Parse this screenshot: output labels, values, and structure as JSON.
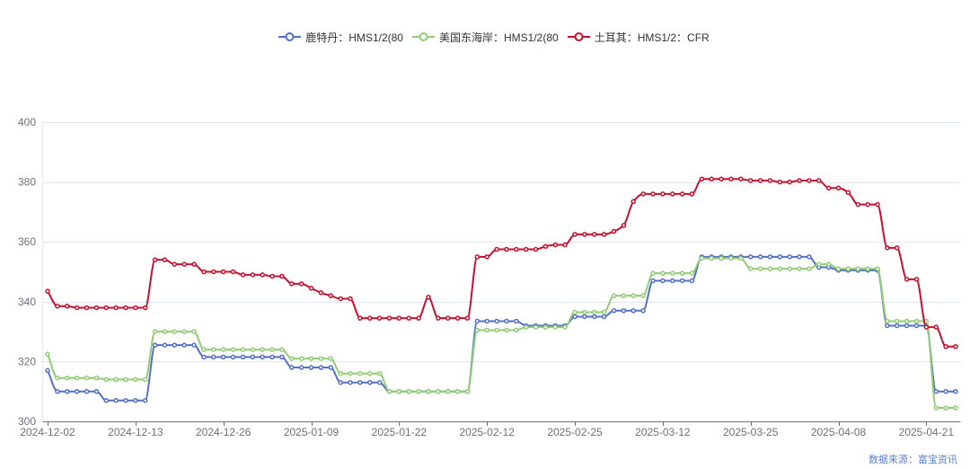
{
  "source": "数据来源：富宝资讯",
  "chart_data": {
    "type": "line",
    "smooth": true,
    "grid": true,
    "legend_position": "top-center",
    "ylim": [
      300,
      400
    ],
    "yticks": [
      300,
      320,
      340,
      360,
      380,
      400
    ],
    "categories": [
      "2024-12-02",
      "",
      "",
      "",
      "",
      "",
      "",
      "",
      "",
      "2024-12-13",
      "",
      "",
      "",
      "",
      "",
      "",
      "",
      "",
      "2024-12-26",
      "",
      "",
      "",
      "",
      "",
      "",
      "",
      "",
      "2025-01-09",
      "",
      "",
      "",
      "",
      "",
      "",
      "",
      "",
      "2025-01-22",
      "",
      "",
      "",
      "",
      "",
      "",
      "",
      "",
      "2025-02-12",
      "",
      "",
      "",
      "",
      "",
      "",
      "",
      "",
      "2025-02-25",
      "",
      "",
      "",
      "",
      "",
      "",
      "",
      "",
      "2025-03-12",
      "",
      "",
      "",
      "",
      "",
      "",
      "",
      "",
      "2025-03-25",
      "",
      "",
      "",
      "",
      "",
      "",
      "",
      "",
      "2025-04-08",
      "",
      "",
      "",
      "",
      "",
      "",
      "",
      "",
      "2025-04-21",
      "",
      "",
      ""
    ],
    "series": [
      {
        "name": "鹿特丹：HMS1/2(80",
        "color": "#5470c6",
        "values": [
          317,
          310,
          310,
          310,
          310,
          310,
          307,
          307,
          307,
          307,
          307,
          325.5,
          325.5,
          325.5,
          325.5,
          325.5,
          321.5,
          321.5,
          321.5,
          321.5,
          321.5,
          321.5,
          321.5,
          321.5,
          321.5,
          318,
          318,
          318,
          318,
          318,
          313,
          313,
          313,
          313,
          313,
          310,
          310,
          310,
          310,
          310,
          310,
          310,
          310,
          310,
          333.5,
          333.5,
          333.5,
          333.5,
          333.5,
          332,
          332,
          332,
          332,
          332,
          335,
          335,
          335,
          335,
          337,
          337,
          337,
          337,
          347,
          347,
          347,
          347,
          347,
          355,
          355,
          355,
          355,
          355,
          355,
          355,
          355,
          355,
          355,
          355,
          355,
          351.5,
          351.5,
          350.5,
          350.5,
          350.5,
          350.5,
          350.5,
          332,
          332,
          332,
          332,
          332,
          310,
          310,
          310
        ]
      },
      {
        "name": "美国东海岸：HMS1/2(80",
        "color": "#91cc75",
        "values": [
          322.5,
          314.5,
          314.5,
          314.5,
          314.5,
          314.5,
          314,
          314,
          314,
          314,
          314,
          330,
          330,
          330,
          330,
          330,
          324,
          324,
          324,
          324,
          324,
          324,
          324,
          324,
          324,
          321,
          321,
          321,
          321,
          321,
          316,
          316,
          316,
          316,
          316,
          310,
          310,
          310,
          310,
          310,
          310,
          310,
          310,
          310,
          330.5,
          330.5,
          330.5,
          330.5,
          330.5,
          331.5,
          331.5,
          331.5,
          331.5,
          331.5,
          336.5,
          336.5,
          336.5,
          336.5,
          342,
          342,
          342,
          342,
          349.5,
          349.5,
          349.5,
          349.5,
          349.5,
          354.5,
          354.5,
          354.5,
          354.5,
          354.5,
          351,
          351,
          351,
          351,
          351,
          351,
          351,
          352.5,
          352.5,
          351,
          351,
          351,
          351,
          351,
          333.5,
          333.5,
          333.5,
          333.5,
          333.5,
          304.5,
          304.5,
          304.5
        ]
      },
      {
        "name": "土耳其：HMS1/2：CFR",
        "color": "#c8102e",
        "values": [
          343.5,
          338.5,
          338.5,
          338,
          338,
          338,
          338,
          338,
          338,
          338,
          338,
          354,
          354,
          352.5,
          352.5,
          352.5,
          350,
          350,
          350,
          350,
          349,
          349,
          349,
          348.5,
          348.5,
          346,
          346,
          344.5,
          343,
          342,
          341,
          341,
          334.5,
          334.5,
          334.5,
          334.5,
          334.5,
          334.5,
          334.5,
          341.5,
          334.5,
          334.5,
          334.5,
          334.5,
          355,
          355,
          357.5,
          357.5,
          357.5,
          357.5,
          357.5,
          358.5,
          359,
          359,
          362.5,
          362.5,
          362.5,
          362.5,
          363.5,
          365.5,
          373.5,
          376,
          376,
          376,
          376,
          376,
          376,
          381,
          381,
          381,
          381,
          381,
          380.5,
          380.5,
          380.5,
          380,
          380,
          380.5,
          380.5,
          380.5,
          378,
          378,
          376.5,
          372.5,
          372.5,
          372.5,
          358,
          358,
          347.5,
          347.5,
          331.5,
          331.5,
          325,
          325
        ]
      }
    ]
  }
}
